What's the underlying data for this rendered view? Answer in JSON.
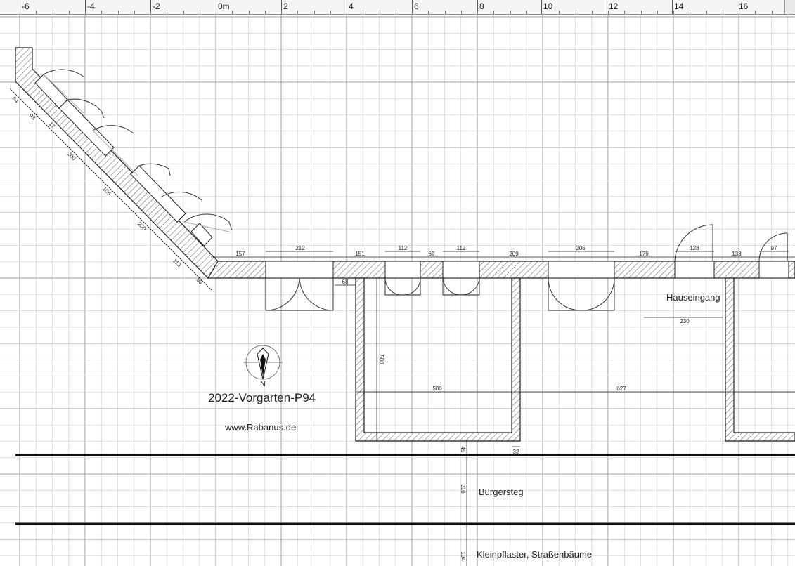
{
  "ruler": {
    "ticks": [
      "-6",
      "-4",
      "-2",
      "0m",
      "2",
      "4",
      "6",
      "8",
      "10",
      "12",
      "14",
      "16"
    ]
  },
  "plan": {
    "title": "2022-Vorgarten-P94",
    "url": "www.Rabanus.de",
    "north_label": "N",
    "entrance_label": "Hauseingang",
    "sidewalk_label": "Bürgersteg",
    "street_label": "Kleinpflaster, Straßenbäume"
  },
  "dimensions": {
    "diagonal": [
      "54",
      "93",
      "17",
      "200",
      "106",
      "200",
      "113",
      "50"
    ],
    "top": [
      "157",
      "212",
      "151",
      "112",
      "69",
      "112",
      "209",
      "205",
      "179",
      "128",
      "133",
      "97"
    ],
    "small_68": "68",
    "entrance_width": "230",
    "bed_depth": "500",
    "bed_width": "500",
    "bed_gap": "627",
    "wall_bottom": "45",
    "wall_thickness": "32",
    "sidewalk_width": "210",
    "street_offset": "194"
  }
}
